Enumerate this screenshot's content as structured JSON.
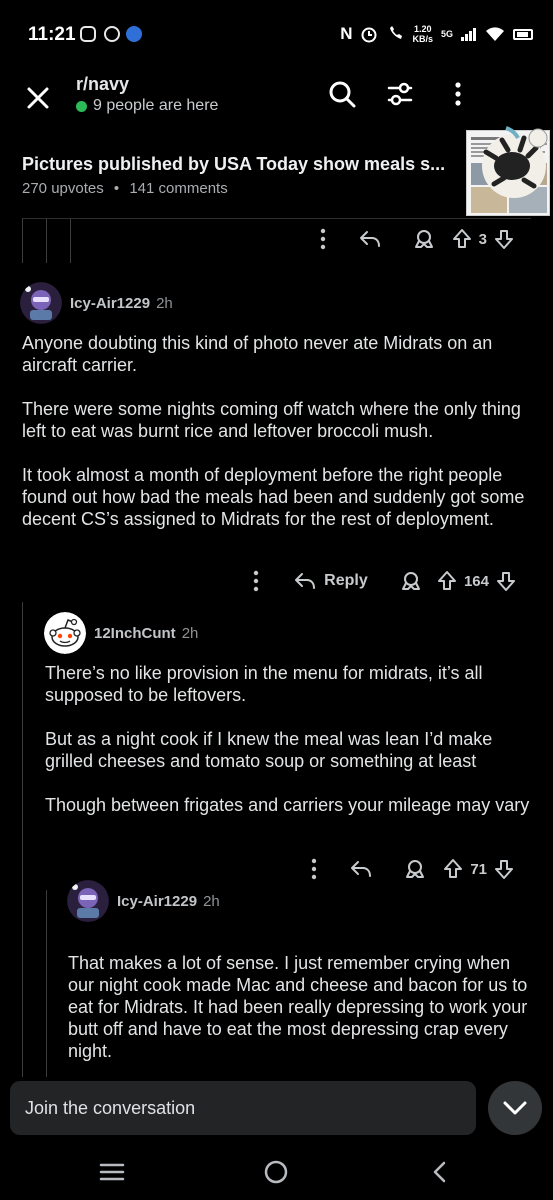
{
  "status_bar": {
    "time": "11:21",
    "network_speed_value": "1.20",
    "network_speed_unit": "KB/s",
    "network_type": "5G"
  },
  "header": {
    "subreddit": "r/navy",
    "online_text": "9 people are here",
    "post_title": "Pictures published by USA Today show meals s...",
    "upvotes": "270 upvotes",
    "separator": "•",
    "comments": "141 comments"
  },
  "top_actions": {
    "score": "3"
  },
  "comments": [
    {
      "user": "Icy-Air1229",
      "time": "2h",
      "paragraphs": [
        "Anyone doubting this kind of photo never ate Midrats on an aircraft carrier.",
        "There were some nights coming off watch where the only thing left to eat was burnt rice and leftover broccoli mush.",
        "It took almost a month of deployment before the right people found out how bad the meals had been and suddenly got some decent CS’s assigned to Midrats for the rest of deployment."
      ],
      "reply_label": "Reply",
      "score": "164"
    },
    {
      "user": "12InchCunt",
      "time": "2h",
      "paragraphs": [
        "There’s no like provision in the menu for midrats, it’s all supposed to be leftovers.",
        "But as a night cook if I knew the meal was lean I’d make grilled cheeses and tomato soup or something at least",
        "Though between frigates and carriers your mileage may vary"
      ],
      "score": "71"
    },
    {
      "user": "Icy-Air1229",
      "time": "2h",
      "paragraphs": [
        "That makes a lot of sense. I just remember crying when our night cook made Mac and cheese and bacon for us to eat for Midrats. It had been really depressing to work your butt off and have to eat the most depressing crap every night."
      ]
    }
  ],
  "composer": {
    "placeholder": "Join the conversation"
  },
  "colors": {
    "background": "#000000",
    "online": "#2dbb58",
    "text": "#e2e4e6",
    "muted": "#8f9396"
  }
}
